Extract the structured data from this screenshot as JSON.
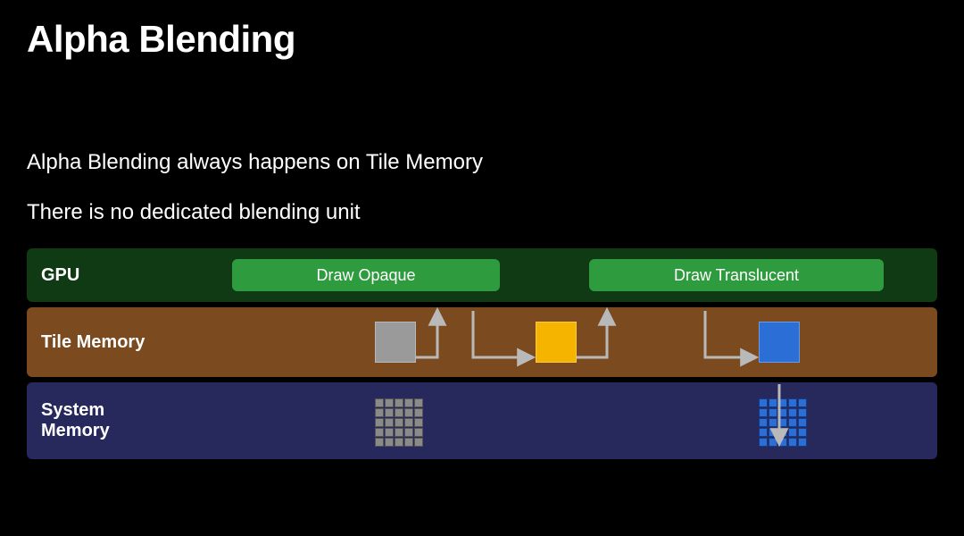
{
  "title": "Alpha Blending",
  "line1": "Alpha Blending always happens on Tile Memory",
  "line2": "There is no dedicated blending unit",
  "rows": {
    "gpu": "GPU",
    "tile": "Tile Memory",
    "sys": "System\nMemory"
  },
  "pills": {
    "opaque": "Draw Opaque",
    "translucent": "Draw Translucent"
  },
  "tiles": {
    "gray": "gray-tile",
    "yellow": "yellow-tile",
    "blue": "blue-tile"
  },
  "colors": {
    "gpu_row": "#0f3a14",
    "tile_row": "#7b4a1e",
    "sys_row": "#27285b",
    "pill": "#2e9b3e",
    "tile_gray": "#9a9a9a",
    "tile_yellow": "#f4b400",
    "tile_blue": "#2b6fd6"
  }
}
